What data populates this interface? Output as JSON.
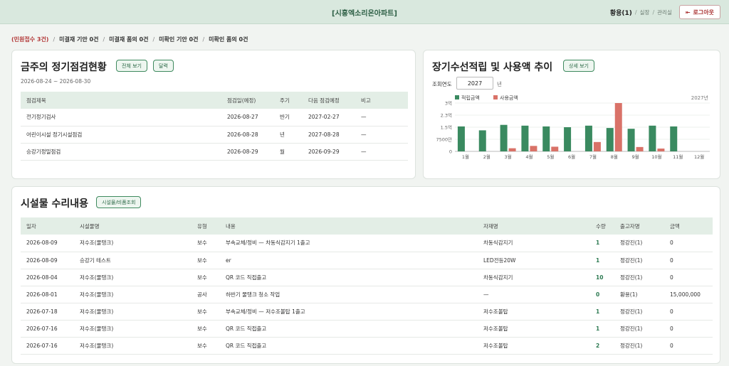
{
  "header": {
    "title": "[시흥엑소리온아파트]",
    "user": "황용(1)",
    "roles": [
      "실장",
      "관리실"
    ],
    "logout_label": "로그아웃"
  },
  "breadcrumbs": [
    {
      "label": "(민원접수 3건)",
      "alert": true
    },
    {
      "label": "미결재 기안 0건",
      "alert": false
    },
    {
      "label": "미결재 품의 0건",
      "alert": false
    },
    {
      "label": "미확인 기안 0건",
      "alert": false
    },
    {
      "label": "미확인 품의 0건",
      "alert": false
    }
  ],
  "inspection": {
    "title": "금주의 정기점검현황",
    "btn_all": "전체 보기",
    "btn_calendar": "달력",
    "date_range": "2026-08-24 ~ 2026-08-30",
    "columns": [
      "점검제목",
      "점검일(예정)",
      "주기",
      "다음 점검예정",
      "비고"
    ],
    "rows": [
      [
        "전기정기검사",
        "2026-08-27",
        "반기",
        "2027-02-27",
        "—"
      ],
      [
        "어린이시설 정기시설점검",
        "2026-08-28",
        "년",
        "2027-08-28",
        "—"
      ],
      [
        "승강기정밀점검",
        "2026-08-29",
        "월",
        "2026-09-29",
        "—"
      ]
    ]
  },
  "fund": {
    "title": "장기수선적립 및 사용액 추이",
    "btn_detail": "상세 보기",
    "year_label": "조회연도",
    "year_value": "2027",
    "year_suffix": "년",
    "colors": {
      "accumulated": "#3a8a60",
      "used": "#d97268"
    }
  },
  "chart_data": {
    "type": "bar",
    "categories": [
      "1월",
      "2월",
      "3월",
      "4월",
      "5월",
      "6월",
      "7월",
      "8월",
      "9월",
      "10월",
      "11월",
      "12월"
    ],
    "series": [
      {
        "name": "적립금액",
        "values": [
          16000,
          13500,
          17000,
          16500,
          16000,
          15500,
          16500,
          15000,
          14500,
          16500,
          16000,
          0
        ]
      },
      {
        "name": "사용금액",
        "values": [
          0,
          0,
          2000,
          3500,
          3000,
          0,
          6000,
          31000,
          2800,
          1800,
          0,
          0
        ]
      }
    ],
    "yticks": [
      "3억",
      "2.3억",
      "1.5억",
      "7500만",
      "0"
    ],
    "ylim": [
      0,
      31000
    ],
    "legend_note": "2027년",
    "legend_position": "top-left"
  },
  "repairs": {
    "title": "시설물 수리내용",
    "btn_query": "시설물/비품조회",
    "columns": [
      "일자",
      "시설물명",
      "유형",
      "내용",
      "자재명",
      "수량",
      "출고자명",
      "금액"
    ],
    "rows": [
      [
        "2026-08-09",
        "저수조(물탱크)",
        "보수",
        "부속교체/정비 — 차동식감지기 1출고",
        "차동식감지기",
        "1",
        "정강진(1)",
        "0"
      ],
      [
        "2026-08-09",
        "승강기 테스트",
        "보수",
        "er",
        "LED전등20W",
        "1",
        "정강진(1)",
        "0"
      ],
      [
        "2026-08-04",
        "저수조(물탱크)",
        "보수",
        "QR 코드 직접출고",
        "차동식감지기",
        "10",
        "정강진(1)",
        "0"
      ],
      [
        "2026-08-01",
        "저수조(물탱크)",
        "공사",
        "하반기 물탱크 청소 작업",
        "—",
        "0",
        "황용(1)",
        "15,000,000"
      ],
      [
        "2026-07-18",
        "저수조(물탱크)",
        "보수",
        "부속교체/정비 — 저수조볼탑 1출고",
        "저수조볼탑",
        "1",
        "정강진(1)",
        "0"
      ],
      [
        "2026-07-16",
        "저수조(물탱크)",
        "보수",
        "QR 코드 직접출고",
        "저수조볼탑",
        "1",
        "정강진(1)",
        "0"
      ],
      [
        "2026-07-16",
        "저수조(물탱크)",
        "보수",
        "QR 코드 직접출고",
        "저수조볼탑",
        "2",
        "정강진(1)",
        "0"
      ]
    ]
  }
}
